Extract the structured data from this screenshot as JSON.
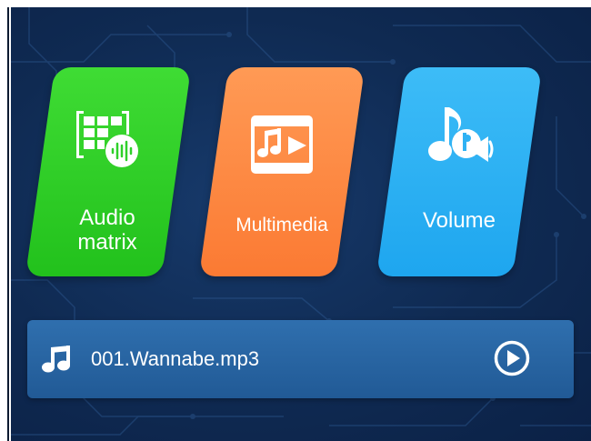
{
  "tiles": [
    {
      "id": "audio_matrix",
      "label_line1": "Audio",
      "label_line2": "matrix",
      "color": "#2fd02a",
      "icon": "audio-matrix-icon"
    },
    {
      "id": "multimedia",
      "label": "Multimedia",
      "color": "#fc8842",
      "icon": "multimedia-icon"
    },
    {
      "id": "volume",
      "label": "Volume",
      "color": "#2fb2f4",
      "icon": "volume-icon"
    }
  ],
  "player": {
    "track": "001.Wannabe.mp3",
    "note_icon": "music-note-icon",
    "play_icon": "play-icon"
  },
  "colors": {
    "background": "#0f2a52",
    "player_bar": "#2766a3",
    "text": "#ffffff"
  }
}
